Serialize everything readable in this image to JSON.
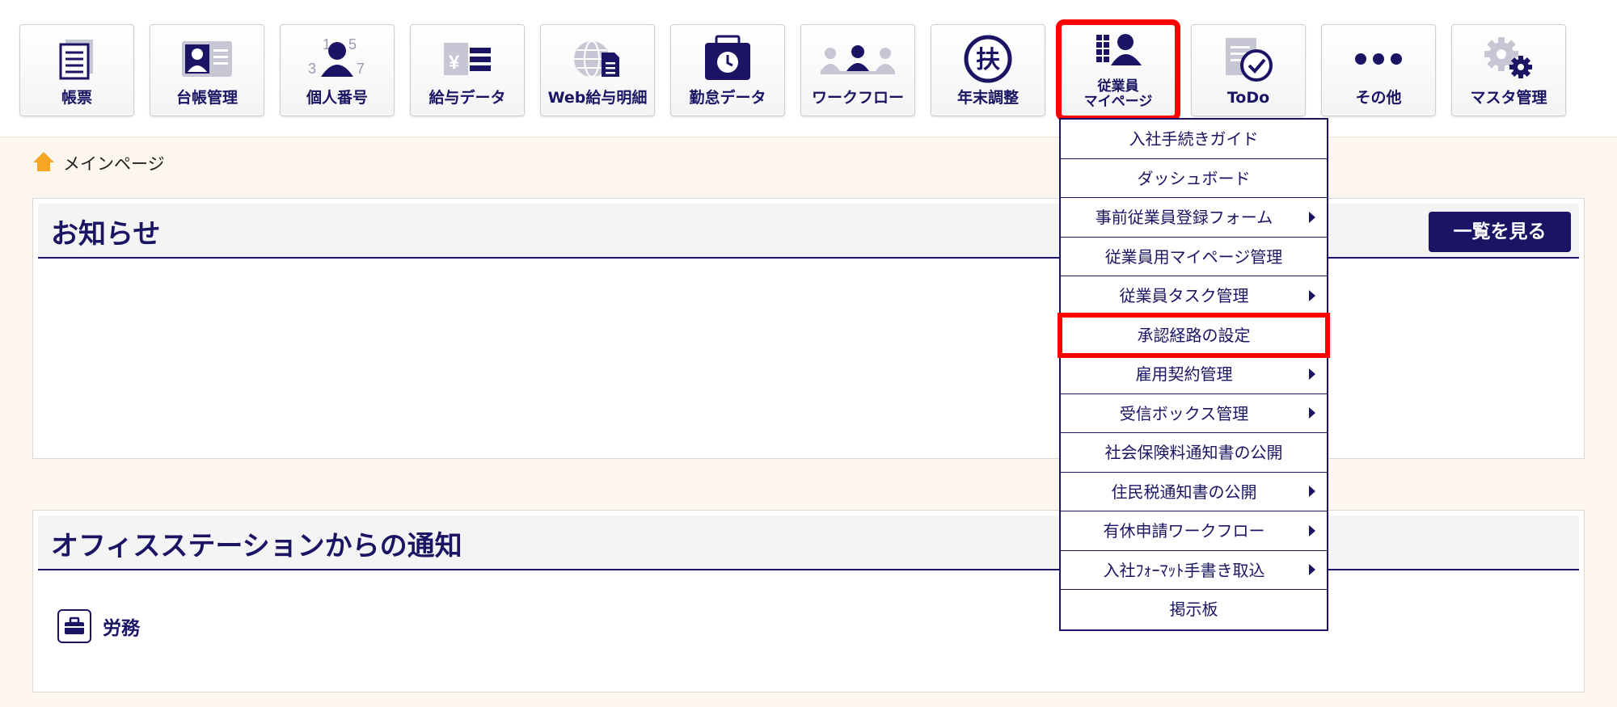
{
  "nav": {
    "items": [
      {
        "label": "帳票",
        "icon": "document-stack-icon"
      },
      {
        "label": "台帳管理",
        "icon": "id-card-icon"
      },
      {
        "label": "個人番号",
        "icon": "person-number-icon"
      },
      {
        "label": "給与データ",
        "icon": "yen-list-icon"
      },
      {
        "label": "Web給与明細",
        "icon": "globe-document-icon"
      },
      {
        "label": "勤怠データ",
        "icon": "timecard-clock-icon"
      },
      {
        "label": "ワークフロー",
        "icon": "people-flow-icon"
      },
      {
        "label": "年末調整",
        "icon": "circled-fu-icon"
      },
      {
        "label": "従業員\nマイページ",
        "icon": "employee-mypage-icon"
      },
      {
        "label": "ToDo",
        "icon": "todo-check-icon"
      },
      {
        "label": "その他",
        "icon": "ellipsis-icon"
      },
      {
        "label": "マスタ管理",
        "icon": "gears-icon"
      }
    ],
    "active_index": 8,
    "icon_glyphs": {
      "person_number_digits": "1 5 3 7",
      "yen_symbol": "¥",
      "fu_char": "扶"
    }
  },
  "breadcrumb": {
    "label": "メインページ",
    "icon": "home-icon"
  },
  "notice": {
    "title": "お知らせ",
    "list_button": "一覧を見る"
  },
  "office": {
    "title": "オフィスステーションからの通知",
    "category_label": "労務",
    "category_icon": "briefcase-icon"
  },
  "dropdown": {
    "items": [
      {
        "label": "入社手続きガイド",
        "submenu": false
      },
      {
        "label": "ダッシュボード",
        "submenu": false
      },
      {
        "label": "事前従業員登録フォーム",
        "submenu": true
      },
      {
        "label": "従業員用マイページ管理",
        "submenu": false
      },
      {
        "label": "従業員タスク管理",
        "submenu": true
      },
      {
        "label": "承認経路の設定",
        "submenu": false
      },
      {
        "label": "雇用契約管理",
        "submenu": true
      },
      {
        "label": "受信ボックス管理",
        "submenu": true
      },
      {
        "label": "社会保険料通知書の公開",
        "submenu": false
      },
      {
        "label": "住民税通知書の公開",
        "submenu": true
      },
      {
        "label": "有休申請ワークフロー",
        "submenu": true
      },
      {
        "label": "入社ﾌｫｰﾏｯﾄ手書き取込",
        "submenu": true
      },
      {
        "label": "掲示板",
        "submenu": false
      }
    ],
    "highlight_index": 5
  },
  "colors": {
    "primary": "#1b1464",
    "highlight": "#ff0000",
    "page_bg": "#fdf6ec",
    "home_icon": "#f5a623"
  }
}
